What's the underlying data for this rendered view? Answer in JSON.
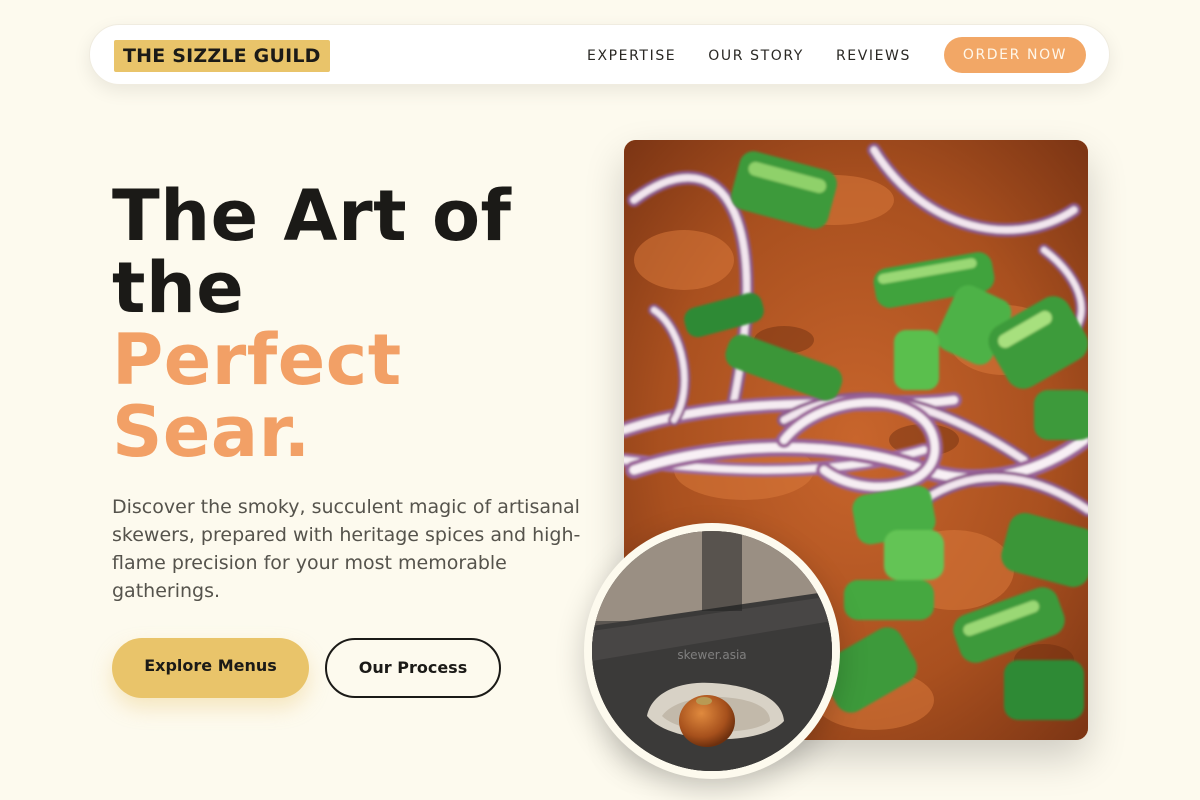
{
  "brand": {
    "name": "THE SIZZLE GUILD"
  },
  "nav": {
    "links": [
      "EXPERTISE",
      "OUR STORY",
      "REVIEWS"
    ],
    "cta": "ORDER NOW"
  },
  "hero": {
    "headline_dark": [
      "The Art of",
      "the"
    ],
    "headline_accent": [
      "Perfect",
      "Sear."
    ],
    "lead": "Discover the smoky, succulent magic of artisanal skewers, prepared with heritage spices and high-flame precision for your most memorable gatherings.",
    "primary_button": "Explore Menus",
    "secondary_button": "Our Process"
  },
  "images": {
    "main_alt": "grilled-skewer-meat-topped-with-onions-and-scallions",
    "circle_watermark": "skewer.asia"
  },
  "colors": {
    "background": "#fdfaee",
    "brand_yellow": "#e9c46a",
    "accent_orange": "#f2a066",
    "text_dark": "#1b1a17"
  }
}
